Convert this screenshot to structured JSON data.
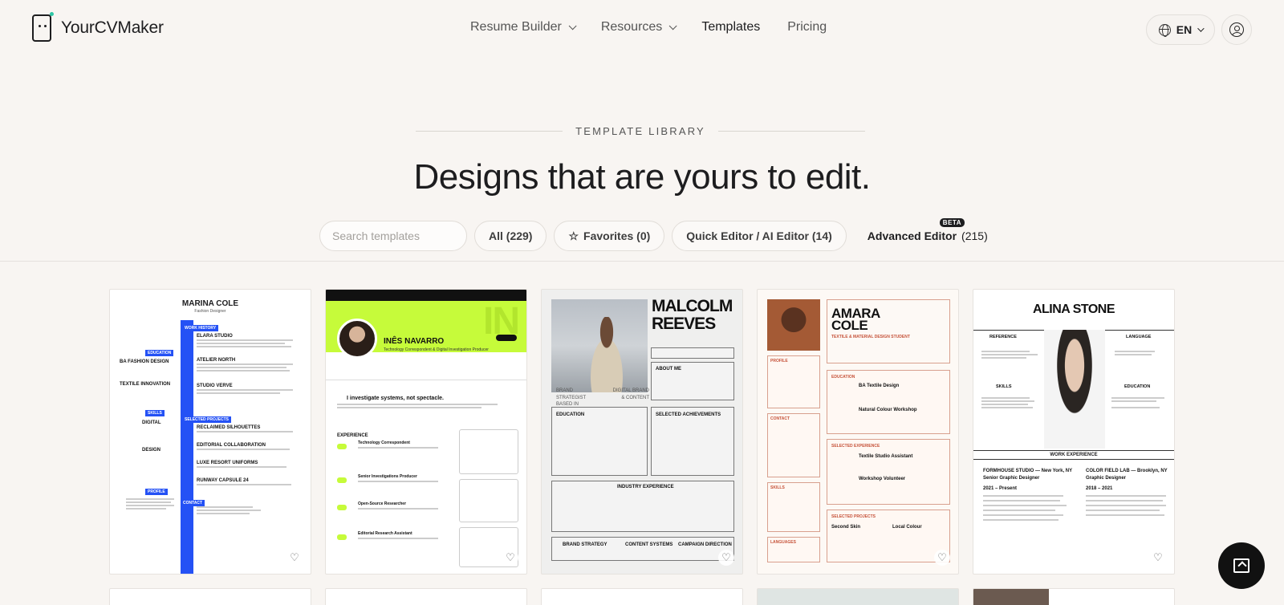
{
  "brand": {
    "name": "YourCVMaker"
  },
  "nav": {
    "items": [
      {
        "label": "Resume Builder",
        "has_dropdown": true
      },
      {
        "label": "Resources",
        "has_dropdown": true
      },
      {
        "label": "Templates",
        "has_dropdown": false,
        "active": true
      },
      {
        "label": "Pricing",
        "has_dropdown": false
      }
    ],
    "language": "EN"
  },
  "hero": {
    "eyebrow": "TEMPLATE LIBRARY",
    "title": "Designs that are yours to edit."
  },
  "filters": {
    "search_placeholder": "Search templates",
    "all": "All (229)",
    "favorites": "Favorites (0)",
    "quick_editor": "Quick Editor / AI Editor (14)",
    "advanced_editor": "Advanced Editor",
    "advanced_count": "(215)",
    "beta_badge": "BETA"
  },
  "cards": [
    {
      "name": "MARINA COLE",
      "subtitle": "Fashion Designer",
      "sections": [
        "WORK HISTORY",
        "EDUCATION",
        "SKILLS",
        "SELECTED PROJECTS",
        "PROFILE",
        "CONTACT"
      ],
      "entries": [
        "ELARA STUDIO",
        "ATELIER NORTH",
        "STUDIO VERVE",
        "RECLAIMED SILHOUETTES",
        "EDITORIAL COLLABORATION",
        "LUXE RESORT UNIFORMS",
        "RUNWAY CAPSULE 24"
      ],
      "left_items": [
        "BA FASHION DESIGN",
        "TEXTILE INNOVATION",
        "DIGITAL",
        "DESIGN"
      ]
    },
    {
      "name": "INÊS NAVARRO",
      "role": "Technology Correspondent & Digital Investigation Producer",
      "banner_text": "IN",
      "quote": "I investigate systems, not spectacle.",
      "section": "EXPERIENCE",
      "jobs": [
        "Technology Correspondent",
        "Senior Investigations Producer",
        "Open-Source Researcher",
        "Editorial Research Assistant"
      ]
    },
    {
      "name_line1": "MALCOLM",
      "name_line2": "REEVES",
      "tagline_left": "BRAND STRATEGIST BASED IN LONDON",
      "tagline_right": "DIGITAL BRAND & CONTENT",
      "sections": [
        "ABOUT ME",
        "EDUCATION",
        "SELECTED ACHIEVEMENTS",
        "INDUSTRY EXPERIENCE"
      ],
      "skills": [
        "BRAND STRATEGY",
        "CONTENT SYSTEMS",
        "CAMPAIGN DIRECTION"
      ]
    },
    {
      "name_line1": "AMARA",
      "name_line2": "COLE",
      "role": "TEXTILE & MATERIAL DESIGN STUDENT",
      "sections": [
        "PROFILE",
        "EDUCATION",
        "CONTACT",
        "SELECTED EXPERIENCE",
        "SKILLS",
        "SELECTED PROJECTS",
        "LANGUAGES"
      ],
      "entries": [
        "BA Textile Design",
        "Natural Colour Workshop",
        "Textile Studio Assistant",
        "Workshop Volunteer",
        "Second Skin",
        "Local Colour"
      ]
    },
    {
      "name": "ALINA STONE",
      "sections": [
        "REFERENCE",
        "LANGUAGE",
        "SKILLS",
        "EDUCATION",
        "WORK EXPERIENCE"
      ],
      "jobs": [
        "FORMHOUSE STUDIO — New York, NY",
        "COLOR FIELD LAB — Brooklyn, NY"
      ],
      "job_titles": [
        "Senior Graphic Designer",
        "Graphic Designer"
      ],
      "years": [
        "2021 – Present",
        "2018 – 2021"
      ]
    }
  ],
  "icons": {
    "favorite": "heart-icon",
    "chat": "chat-icon",
    "language": "globe-icon",
    "account": "user-icon"
  }
}
